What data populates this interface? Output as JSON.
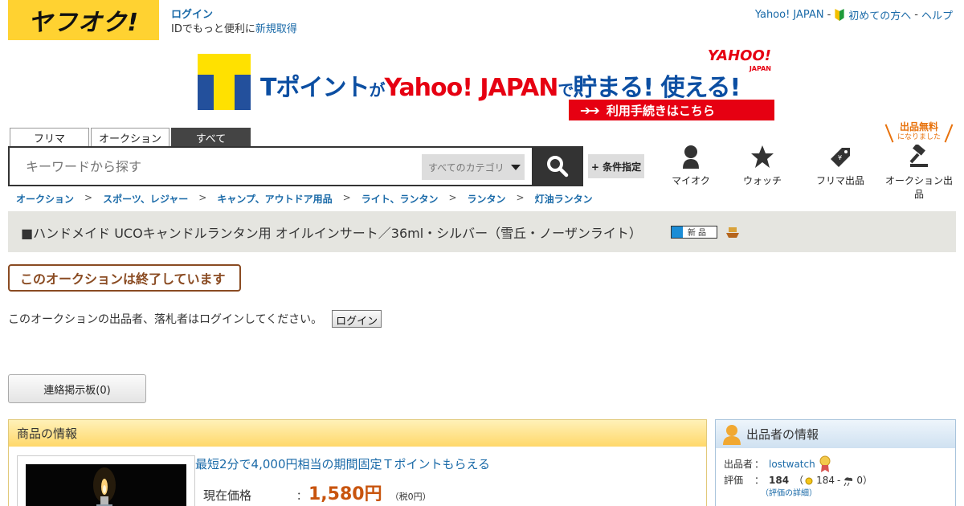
{
  "header": {
    "logo_text": "ヤフオク!",
    "login_label": "ログイン",
    "id_prompt": "IDでもっと便利に",
    "register_link": "新規取得",
    "yahoo_japan_link": "Yahoo! JAPAN",
    "separator1": "-",
    "beginners_link": "初めての方へ",
    "separator2": "-",
    "help_link": "ヘルプ"
  },
  "banner": {
    "t_point": "Tポイント",
    "ga": "が",
    "yahoo": "Yahoo! JAPAN",
    "de": "で",
    "tameru": "貯まる! 使える!",
    "corner_logo": "YAHOO!",
    "corner_sub": "JAPAN",
    "cta": "利用手続きはこちら",
    "cta_arrows": "➔➔"
  },
  "search": {
    "tabs": [
      {
        "label": "フリマ"
      },
      {
        "label": "オークション"
      },
      {
        "label": "すべて"
      }
    ],
    "placeholder": "キーワードから探す",
    "category": "すべてのカテゴリ",
    "conditions_button": "+ 条件指定"
  },
  "nav": {
    "my_auction": "マイオク",
    "watch": "ウォッチ",
    "flea_listing": "フリマ出品",
    "auction_listing": "オークション出品",
    "free_badge_title": "出品無料",
    "free_badge_sub": "になりました"
  },
  "breadcrumb": [
    {
      "label": "オークション"
    },
    {
      "label": "スポーツ、レジャー"
    },
    {
      "label": "キャンプ、アウトドア用品"
    },
    {
      "label": "ライト、ランタン"
    },
    {
      "label": "ランタン"
    },
    {
      "label": "灯油ランタン"
    }
  ],
  "breadcrumb_separator": ">",
  "item": {
    "title": "■ハンドメイド UCOキャンドルランタン用 オイルインサート／36ml・シルバー（雪丘・ノーザンライト）",
    "condition_badge": "新 品"
  },
  "auction_status": {
    "ended_message": "このオークションは終了しています",
    "login_note": "このオークションの出品者、落札者はログインしてください。",
    "login_button": "ログイン",
    "board_button": "連絡掲示板(0)"
  },
  "product_info": {
    "heading": "商品の情報",
    "tpoint_link": "最短2分で4,000円相当の期間固定Ｔポイントもらえる",
    "price_label": "現在価格",
    "price_colon": "：",
    "price_value": "1,580円",
    "price_tax": "（税0円）"
  },
  "seller_info": {
    "heading": "出品者の情報",
    "seller_key": "出品者",
    "seller_colon": "：",
    "seller_name": "lostwatch",
    "rating_key": "評価",
    "rating_colon": "：",
    "rating_total": "184",
    "rating_open": "（",
    "rating_good": "184",
    "rating_dash": "-",
    "rating_bad": "0",
    "rating_close": "）",
    "rating_detail_link": "（評価の詳細）"
  },
  "colors": {
    "logo_yellow": "#ffd231",
    "link_blue": "#1a6aa8",
    "price_orange": "#c8540d",
    "ended_brown": "#8a4b22",
    "tpoint_blue": "#0b4ea2",
    "yahoo_red": "#e60012"
  }
}
